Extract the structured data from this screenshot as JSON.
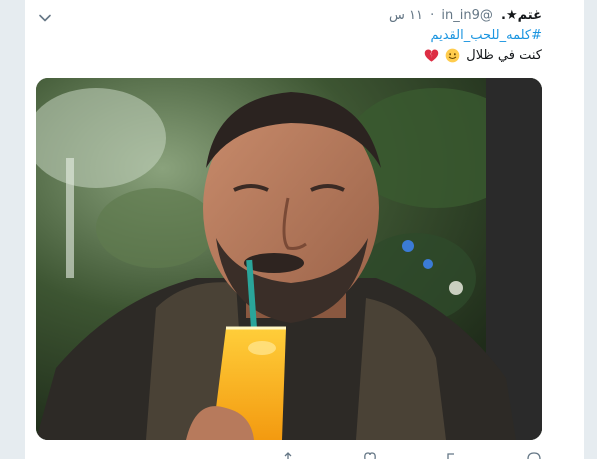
{
  "tweet": {
    "display_name": "غتم★.",
    "handle": "@in_in9",
    "separator": "·",
    "time": "١١ س",
    "hashtag": "#كلمه_للحب_القديم",
    "text": "كنت في ظلال",
    "emojis": [
      "smiling-face",
      "broken-heart"
    ]
  },
  "icons": {
    "menu": "chevron-down-icon",
    "actions": [
      "reply-icon",
      "retweet-icon",
      "like-icon",
      "share-icon"
    ]
  },
  "colors": {
    "link": "#1b95e0",
    "text": "#14171a",
    "secondary": "#657786",
    "background": "#e6ecf0"
  }
}
